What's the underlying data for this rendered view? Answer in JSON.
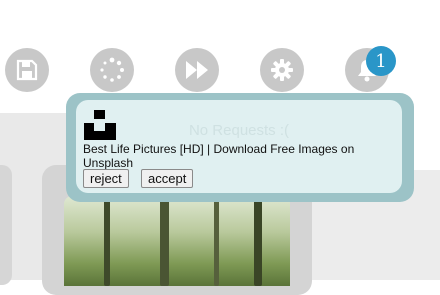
{
  "toolbar": {
    "buttons": [
      {
        "icon": "floppy-disk-icon"
      },
      {
        "icon": "loading-spinner-icon"
      },
      {
        "icon": "fast-forward-icon"
      },
      {
        "icon": "gear-icon"
      },
      {
        "icon": "bell-icon"
      }
    ],
    "notification_count": "1"
  },
  "popup": {
    "empty_text": "No Requests :(",
    "request": {
      "site_icon": "unsplash-logo-icon",
      "title": "Best Life Pictures [HD] | Download Free Images on Unsplash",
      "reject_label": "reject",
      "accept_label": "accept"
    }
  },
  "colors": {
    "toolbar_button": "#c8c8c8",
    "badge": "#2a96c8",
    "popup_border": "#9cc3c7",
    "popup_fill": "#e0f0f1"
  }
}
